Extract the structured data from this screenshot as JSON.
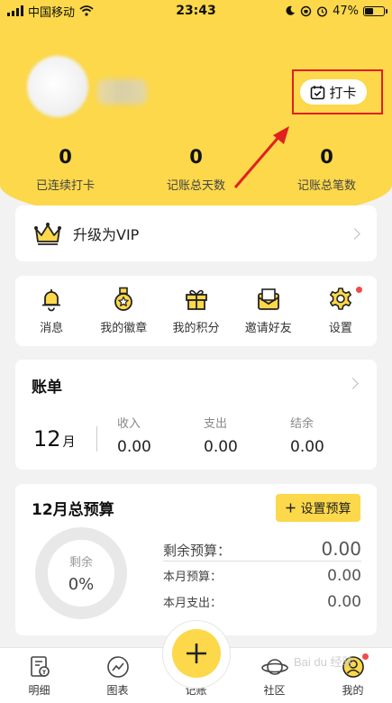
{
  "status_bar": {
    "carrier": "中国移动",
    "time": "23:43",
    "battery": "47%",
    "battery_level": 0.47
  },
  "profile": {
    "checkin_label": "打卡"
  },
  "stats": [
    {
      "value": "0",
      "label": "已连续打卡"
    },
    {
      "value": "0",
      "label": "记账总天数"
    },
    {
      "value": "0",
      "label": "记账总笔数"
    }
  ],
  "vip": {
    "label": "升级为VIP",
    "icon": "crown-icon"
  },
  "menu": [
    {
      "label": "消息",
      "icon": "bell-icon"
    },
    {
      "label": "我的徽章",
      "icon": "medal-icon"
    },
    {
      "label": "我的积分",
      "icon": "gift-icon"
    },
    {
      "label": "邀请好友",
      "icon": "envelope-icon"
    },
    {
      "label": "设置",
      "icon": "gear-icon",
      "dot": true
    }
  ],
  "bill": {
    "title": "账单",
    "month_num": "12",
    "month_unit": "月",
    "income_label": "收入",
    "income_value": "0.00",
    "expense_label": "支出",
    "expense_value": "0.00",
    "balance_label": "结余",
    "balance_value": "0.00"
  },
  "budget": {
    "title": "12月总预算",
    "set_button": "设置预算",
    "donut_label": "剩余",
    "donut_value": "0%",
    "remaining_label": "剩余预算：",
    "remaining_value": "0.00",
    "month_budget_label": "本月预算：",
    "month_budget_value": "0.00",
    "month_expense_label": "本月支出：",
    "month_expense_value": "0.00"
  },
  "tabbar": [
    {
      "label": "明细",
      "icon": "ledger-icon"
    },
    {
      "label": "图表",
      "icon": "chart-icon"
    },
    {
      "label": "记账",
      "icon": "plus-icon"
    },
    {
      "label": "社区",
      "icon": "planet-icon"
    },
    {
      "label": "我的",
      "icon": "profile-icon",
      "dot": true
    }
  ],
  "watermark": "Bai du 经验",
  "colors": {
    "brand_yellow": "#fcd84a",
    "highlight_red": "#e02020",
    "dot_red": "#f04b4b"
  }
}
